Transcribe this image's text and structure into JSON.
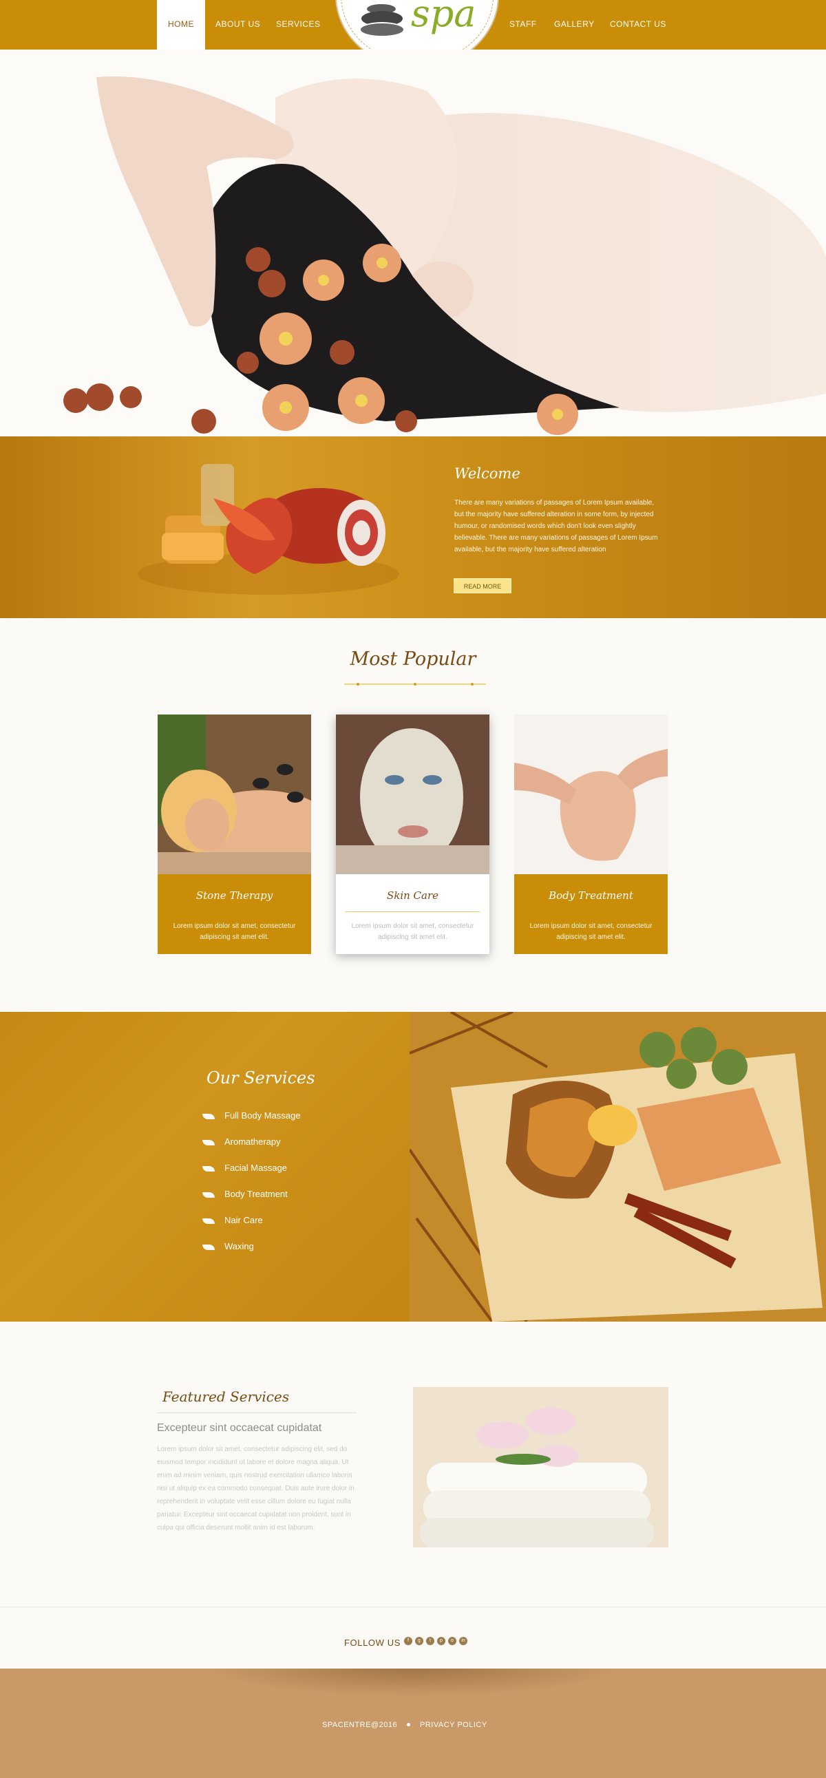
{
  "nav": {
    "items": [
      "HOME",
      "ABOUT US",
      "SERVICES",
      "STAFF",
      "GALLERY",
      "CONTACT US"
    ],
    "active": "HOME",
    "logo_text": "spa"
  },
  "welcome": {
    "title": "Welcome",
    "text": "There are many variations of passages of Lorem Ipsum available, but the majority have suffered alteration in some form, by injected humour, or randomised words which don't look even slightly believable. There are many variations of passages of Lorem Ipsum available, but the majority have suffered alteration",
    "button": "READ MORE"
  },
  "most_popular": {
    "title": "Most Popular",
    "cards": [
      {
        "title": "Stone Therapy",
        "text": "Lorem ipsum dolor sit amet, consectetur adipiscing sit amet elit."
      },
      {
        "title": "Skin Care",
        "text": "Lorem ipsum dolor sit amet, consectetur adipiscing sit amet elit."
      },
      {
        "title": "Body Treatment",
        "text": "Lorem ipsum dolor sit amet, consectetur adipiscing sit amet elit."
      }
    ]
  },
  "services": {
    "title": "Our Services",
    "items": [
      "Full Body Massage",
      "Aromatherapy",
      "Facial Massage",
      "Body Treatment",
      "Nair Care",
      "Waxing"
    ]
  },
  "featured": {
    "title": "Featured Services",
    "subtitle": "Excepteur sint occaecat cupidatat",
    "text": "Lorem ipsum dolor sit amet, consectetur adipiscing elit, sed do eiusmod tempor incididunt ut labore et dolore magna aliqua. Ut enim ad minim veniam, quis nostrud exercitation ullamco laboris nisi ut aliquip ex ea commodo consequat. Duis aute irure dolor in reprehenderit in voluptate velit esse cillum dolore eu fugiat nulla pariatur. Excepteur sint occaecat cupidatat non proident, sunt in culpa qui officia deserunt mollit anim id est laborum."
  },
  "follow": {
    "label": "FOLLOW US",
    "icons": [
      "facebook-icon",
      "google-plus-icon",
      "twitter-icon",
      "pinterest-icon",
      "instagram-icon",
      "linkedin-icon"
    ]
  },
  "footer": {
    "copyright": "SPACENTRE@2016",
    "privacy": "PRIVACY POLICY"
  },
  "colors": {
    "accent": "#c98d08",
    "heading": "#7a4a14",
    "footer": "#c99a68"
  }
}
